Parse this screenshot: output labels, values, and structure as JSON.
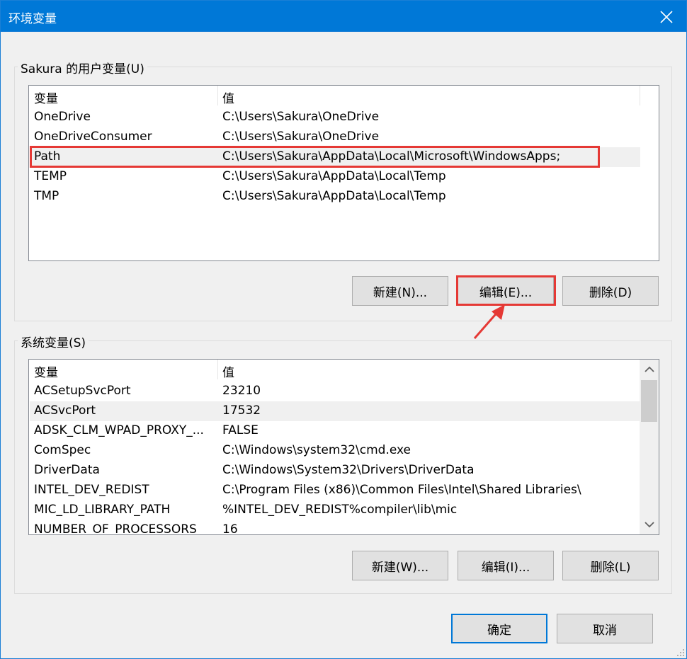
{
  "window": {
    "title": "环境变量"
  },
  "user_vars": {
    "group_label": "Sakura 的用户变量(U)",
    "headers": [
      "变量",
      "值"
    ],
    "rows": [
      [
        "OneDrive",
        "C:\\Users\\Sakura\\OneDrive"
      ],
      [
        "OneDriveConsumer",
        "C:\\Users\\Sakura\\OneDrive"
      ],
      [
        "Path",
        "C:\\Users\\Sakura\\AppData\\Local\\Microsoft\\WindowsApps;"
      ],
      [
        "TEMP",
        "C:\\Users\\Sakura\\AppData\\Local\\Temp"
      ],
      [
        "TMP",
        "C:\\Users\\Sakura\\AppData\\Local\\Temp"
      ]
    ],
    "buttons": {
      "new": "新建(N)...",
      "edit": "编辑(E)...",
      "delete": "删除(D)"
    }
  },
  "system_vars": {
    "group_label": "系统变量(S)",
    "headers": [
      "变量",
      "值"
    ],
    "rows": [
      [
        "ACSetupSvcPort",
        "23210"
      ],
      [
        "ACSvcPort",
        "17532"
      ],
      [
        "ADSK_CLM_WPAD_PROXY_...",
        "FALSE"
      ],
      [
        "ComSpec",
        "C:\\Windows\\system32\\cmd.exe"
      ],
      [
        "DriverData",
        "C:\\Windows\\System32\\Drivers\\DriverData"
      ],
      [
        "INTEL_DEV_REDIST",
        "C:\\Program Files (x86)\\Common Files\\Intel\\Shared Libraries\\"
      ],
      [
        "MIC_LD_LIBRARY_PATH",
        "%INTEL_DEV_REDIST%compiler\\lib\\mic"
      ],
      [
        "NUMBER_OF_PROCESSORS",
        "16"
      ]
    ],
    "buttons": {
      "new": "新建(W)...",
      "edit": "编辑(I)...",
      "delete": "删除(L)"
    }
  },
  "footer": {
    "ok": "确定",
    "cancel": "取消"
  },
  "colors": {
    "accent": "#0078d7",
    "annotation": "#e53935"
  }
}
